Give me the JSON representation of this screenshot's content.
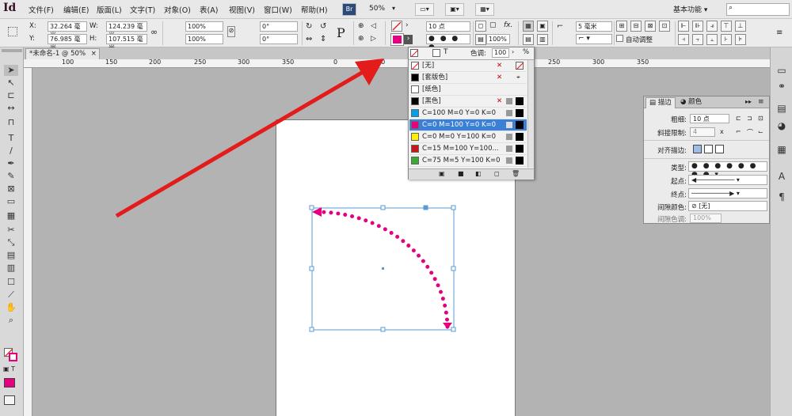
{
  "app": {
    "logo": "Id"
  },
  "menu": [
    "文件(F)",
    "编辑(E)",
    "版面(L)",
    "文字(T)",
    "对象(O)",
    "表(A)",
    "视图(V)",
    "窗口(W)",
    "帮助(H)"
  ],
  "menubar": {
    "bridge_label": "Br",
    "zoom": "50%",
    "workspace": "基本功能",
    "workspace_arrow": "▾",
    "search_icon": "⌕"
  },
  "control": {
    "x_label": "X:",
    "x_value": "32.264 毫米",
    "y_label": "Y:",
    "y_value": "76.985 毫米",
    "w_label": "W:",
    "w_value": "124.239 毫米",
    "h_label": "H:",
    "h_value": "107.515 毫米",
    "scale_x": "100%",
    "scale_y": "100%",
    "rotate": "0°",
    "shear": "0°",
    "stroke_weight": "10 点",
    "opacity": "100%",
    "mm_value": "5 毫米",
    "auto_fit_label": "自动调整",
    "fx_label": "fx."
  },
  "tab": {
    "title": "*未命名-1 @ 50%",
    "close": "×"
  },
  "ruler": {
    "labels": [
      "100",
      "150",
      "200",
      "250",
      "300",
      "350",
      "0",
      "50",
      "100",
      "150",
      "200",
      "250",
      "300",
      "350"
    ]
  },
  "swatch_panel": {
    "tint_label": "色调:",
    "tint_value": "100",
    "tint_unit": "%",
    "T_label": "T",
    "swatches": [
      {
        "name": "[无]",
        "color": "#ffffff"
      },
      {
        "name": "[套版色]",
        "color": "#000000"
      },
      {
        "name": "[纸色]",
        "color": "#ffffff"
      },
      {
        "name": "[黑色]",
        "color": "#000000"
      },
      {
        "name": "C=100 M=0 Y=0 K=0",
        "color": "#00a0e9"
      },
      {
        "name": "C=0 M=100 Y=0 K=0",
        "color": "#e4007f"
      },
      {
        "name": "C=0 M=0 Y=100 K=0",
        "color": "#fff100"
      },
      {
        "name": "C=15 M=100 Y=100...",
        "color": "#c8161d"
      },
      {
        "name": "C=75 M=5 Y=100 K=0",
        "color": "#3aa935"
      }
    ]
  },
  "stroke_panel": {
    "tab_stroke": "描边",
    "tab_color": "颜色",
    "weight_label": "粗细:",
    "weight_value": "10 点",
    "miter_label": "斜接限制:",
    "miter_value": "4",
    "miter_x": "x",
    "align_label": "对齐描边:",
    "type_label": "类型:",
    "start_label": "起点:",
    "end_label": "终点:",
    "gap_color_label": "间隙颜色:",
    "gap_color_value": "[无]",
    "gap_tint_label": "间隙色调:",
    "gap_tint_value": "100%"
  },
  "colors": {
    "accent_magenta": "#e4007f",
    "highlight_red": "#e31b1b",
    "selection_blue": "#3b80d8",
    "frame_blue": "#5a9bd5"
  }
}
